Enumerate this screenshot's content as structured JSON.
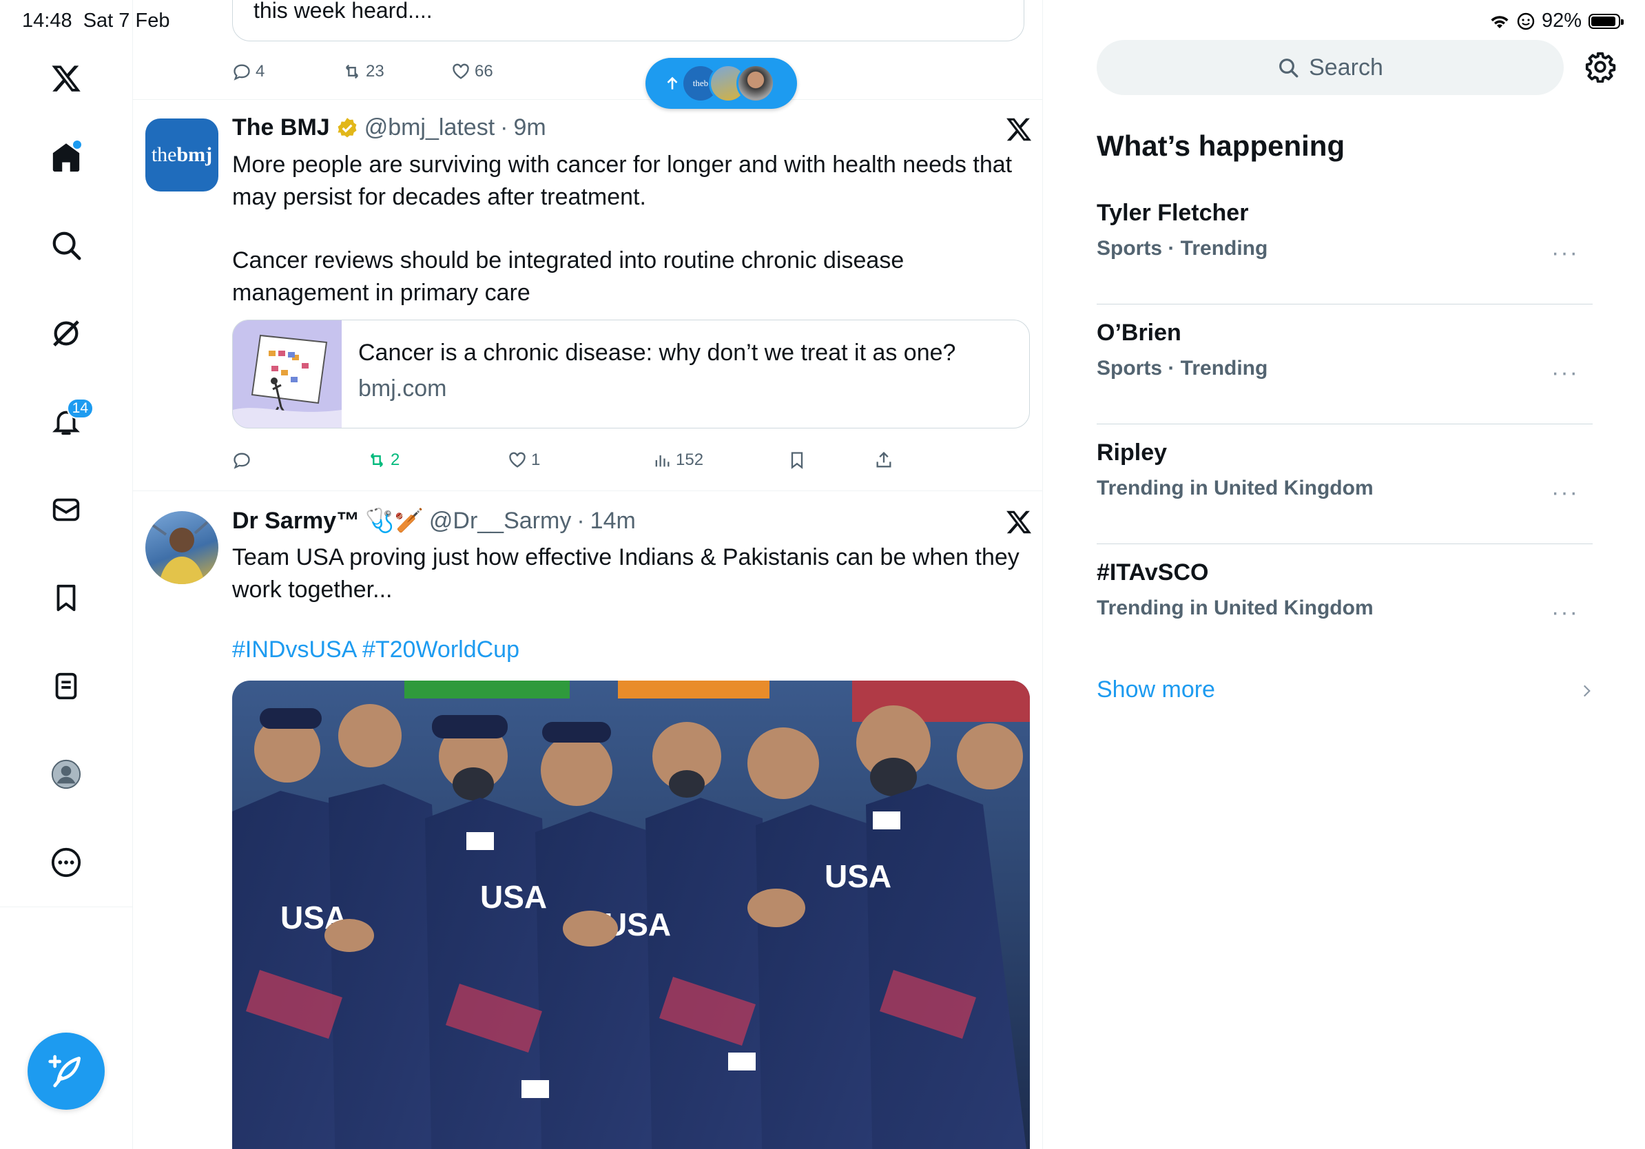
{
  "status_bar": {
    "time": "14:48",
    "date": "Sat 7 Feb",
    "battery": "92%",
    "battery_level": 0.92
  },
  "nav": {
    "items": [
      "x-logo",
      "home",
      "search",
      "grok",
      "notifications",
      "messages",
      "bookmarks",
      "lists",
      "profile",
      "more"
    ],
    "notifications_badge": "14",
    "compose_icon": "compose-feather-icon"
  },
  "new_posts_pill": {
    "mini_avatar_text": "theb"
  },
  "prev_tweet": {
    "text": "this week heard....",
    "replies": "4",
    "reposts": "23",
    "likes": "66"
  },
  "tweets": [
    {
      "name": "The BMJ",
      "verified": true,
      "handle": "@bmj_latest",
      "sep": "·",
      "time": "9m",
      "avatar_text_light": "the",
      "avatar_text_bold": "bmj",
      "paragraph_1": "More people are surviving with cancer for longer and with health needs that may persist for decades after treatment.",
      "paragraph_2": "Cancer reviews should be integrated into routine chronic disease management in primary care",
      "link_card": {
        "title": "Cancer is a chronic disease: why don’t we treat it as one?",
        "domain": "bmj.com"
      },
      "replies": "",
      "reposts": "2",
      "likes": "1",
      "views": "152"
    },
    {
      "name": "Dr Sarmy™",
      "name_emoji": "🩺🏏",
      "handle": "@Dr__Sarmy",
      "sep": "·",
      "time": "14m",
      "text": "Team USA proving just how effective Indians & Pakistanis can be when they work together...",
      "hashtags": "#INDvsUSA #T20WorldCup"
    }
  ],
  "sidebar": {
    "search_placeholder": "Search",
    "section_title": "What’s happening",
    "trends": [
      {
        "name": "Tyler Fletcher",
        "meta": "Sports · Trending"
      },
      {
        "name": "O’Brien",
        "meta": "Sports · Trending"
      },
      {
        "name": "Ripley",
        "meta": "Trending in United Kingdom"
      },
      {
        "name": "#ITAvSCO",
        "meta": "Trending in United Kingdom"
      }
    ],
    "more_glyph": "···",
    "show_more": "Show more"
  },
  "colors": {
    "accent": "#1d9bf0",
    "repost_active": "#00ba7c",
    "text": "#0f1419",
    "muted": "#536471"
  }
}
